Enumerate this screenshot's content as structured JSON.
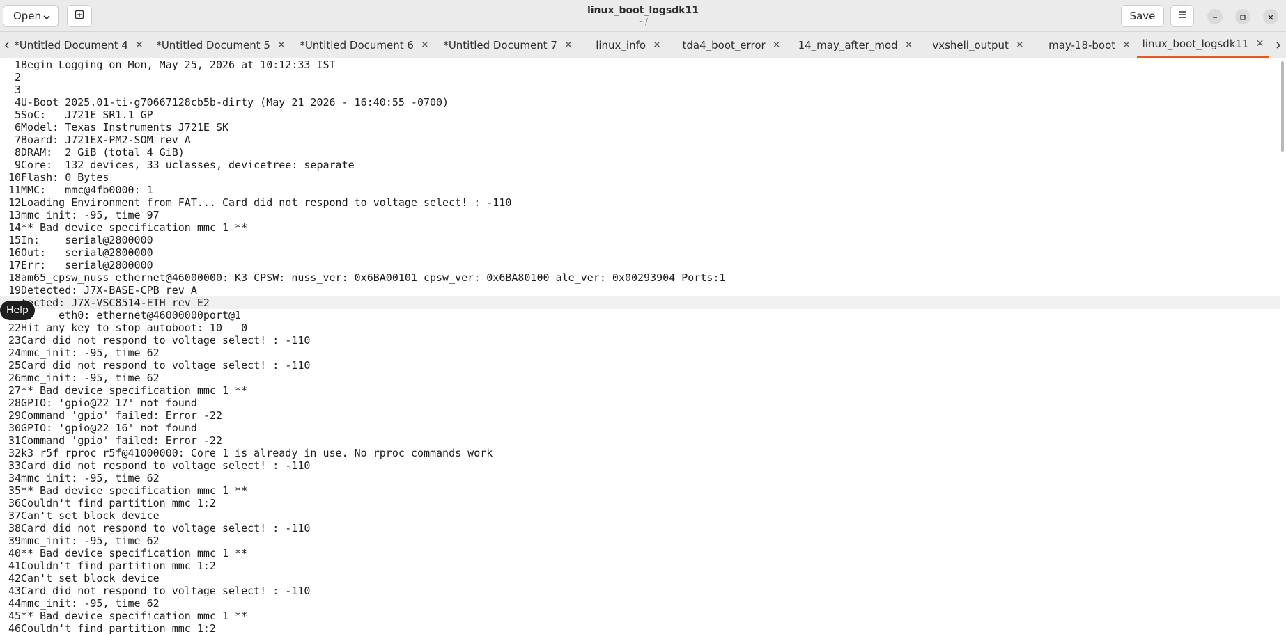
{
  "header": {
    "open_label": "Open",
    "title": "linux_boot_logsdk11",
    "subtitle": "~/",
    "save_label": "Save"
  },
  "tabs": [
    {
      "label": "*Untitled Document 4",
      "active": false
    },
    {
      "label": "*Untitled Document 5",
      "active": false
    },
    {
      "label": "*Untitled Document 6",
      "active": false
    },
    {
      "label": "*Untitled Document 7",
      "active": false
    },
    {
      "label": "linux_info",
      "active": false
    },
    {
      "label": "tda4_boot_error",
      "active": false
    },
    {
      "label": "14_may_after_mod",
      "active": false
    },
    {
      "label": "vxshell_output",
      "active": false
    },
    {
      "label": "may-18-boot",
      "active": false
    },
    {
      "label": "linux_boot_logsdk11",
      "active": true
    }
  ],
  "tooltip": {
    "label": "Help"
  },
  "colors": {
    "accent": "#e95420",
    "background": "#ffffff",
    "headerbar": "#ebebeb"
  },
  "editor": {
    "lines": [
      {
        "n": "1",
        "text": "Begin Logging on Mon, May 25, 2026 at 10:12:33 IST"
      },
      {
        "n": "2",
        "text": ""
      },
      {
        "n": "3",
        "text": ""
      },
      {
        "n": "4",
        "text": "U-Boot 2025.01-ti-g70667128cb5b-dirty (May 21 2026 - 16:40:55 -0700)"
      },
      {
        "n": "5",
        "text": "SoC:   J721E SR1.1 GP"
      },
      {
        "n": "6",
        "text": "Model: Texas Instruments J721E SK"
      },
      {
        "n": "7",
        "text": "Board: J721EX-PM2-SOM rev A"
      },
      {
        "n": "8",
        "text": "DRAM:  2 GiB (total 4 GiB)"
      },
      {
        "n": "9",
        "text": "Core:  132 devices, 33 uclasses, devicetree: separate"
      },
      {
        "n": "10",
        "text": "Flash: 0 Bytes"
      },
      {
        "n": "11",
        "text": "MMC:   mmc@4fb0000: 1"
      },
      {
        "n": "12",
        "text": "Loading Environment from FAT... Card did not respond to voltage select! : -110"
      },
      {
        "n": "13",
        "text": "mmc_init: -95, time 97"
      },
      {
        "n": "14",
        "text": "** Bad device specification mmc 1 **"
      },
      {
        "n": "15",
        "text": "In:    serial@2800000"
      },
      {
        "n": "16",
        "text": "Out:   serial@2800000"
      },
      {
        "n": "17",
        "text": "Err:   serial@2800000"
      },
      {
        "n": "18",
        "text": "am65_cpsw_nuss ethernet@46000000: K3 CPSW: nuss_ver: 0x6BA00101 cpsw_ver: 0x6BA80100 ale_ver: 0x00293904 Ports:1"
      },
      {
        "n": "19",
        "text": "Detected: J7X-BASE-CPB rev A"
      },
      {
        "n": "",
        "text": "tected: J7X-VSC8514-ETH rev E2",
        "current": true
      },
      {
        "n": "",
        "text": "t:    eth0: ethernet@46000000port@1"
      },
      {
        "n": "22",
        "text": "Hit any key to stop autoboot: 10   0"
      },
      {
        "n": "23",
        "text": "Card did not respond to voltage select! : -110"
      },
      {
        "n": "24",
        "text": "mmc_init: -95, time 62"
      },
      {
        "n": "25",
        "text": "Card did not respond to voltage select! : -110"
      },
      {
        "n": "26",
        "text": "mmc_init: -95, time 62"
      },
      {
        "n": "27",
        "text": "** Bad device specification mmc 1 **"
      },
      {
        "n": "28",
        "text": "GPIO: 'gpio@22_17' not found"
      },
      {
        "n": "29",
        "text": "Command 'gpio' failed: Error -22"
      },
      {
        "n": "30",
        "text": "GPIO: 'gpio@22_16' not found"
      },
      {
        "n": "31",
        "text": "Command 'gpio' failed: Error -22"
      },
      {
        "n": "32",
        "text": "k3_r5f_rproc r5f@41000000: Core 1 is already in use. No rproc commands work"
      },
      {
        "n": "33",
        "text": "Card did not respond to voltage select! : -110"
      },
      {
        "n": "34",
        "text": "mmc_init: -95, time 62"
      },
      {
        "n": "35",
        "text": "** Bad device specification mmc 1 **"
      },
      {
        "n": "36",
        "text": "Couldn't find partition mmc 1:2"
      },
      {
        "n": "37",
        "text": "Can't set block device"
      },
      {
        "n": "38",
        "text": "Card did not respond to voltage select! : -110"
      },
      {
        "n": "39",
        "text": "mmc_init: -95, time 62"
      },
      {
        "n": "40",
        "text": "** Bad device specification mmc 1 **"
      },
      {
        "n": "41",
        "text": "Couldn't find partition mmc 1:2"
      },
      {
        "n": "42",
        "text": "Can't set block device"
      },
      {
        "n": "43",
        "text": "Card did not respond to voltage select! : -110"
      },
      {
        "n": "44",
        "text": "mmc_init: -95, time 62"
      },
      {
        "n": "45",
        "text": "** Bad device specification mmc 1 **"
      },
      {
        "n": "46",
        "text": "Couldn't find partition mmc 1:2"
      }
    ]
  }
}
